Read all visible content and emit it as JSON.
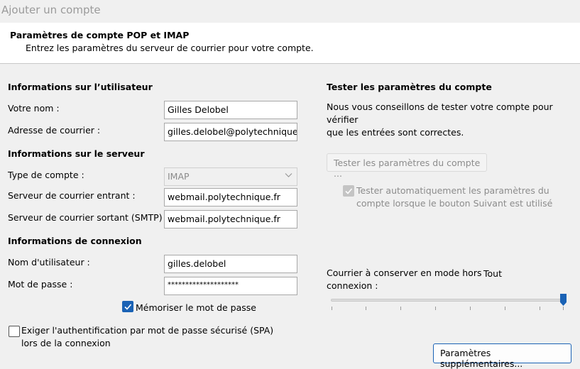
{
  "window": {
    "title": "Ajouter un compte"
  },
  "header": {
    "title": "Paramètres de compte POP et IMAP",
    "subtitle": "Entrez les paramètres du serveur de courrier pour votre compte."
  },
  "user_info": {
    "heading": "Informations sur l’utilisateur",
    "name_label": "Votre nom :",
    "name_value": "Gilles Delobel",
    "email_label": "Adresse de courrier :",
    "email_value": "gilles.delobel@polytechnique.e"
  },
  "server_info": {
    "heading": "Informations sur le serveur",
    "account_type_label": "Type de compte :",
    "account_type_value": "IMAP",
    "incoming_label": "Serveur de courrier entrant :",
    "incoming_value": "webmail.polytechnique.fr",
    "outgoing_label": "Serveur de courrier sortant (SMTP) :",
    "outgoing_value": "webmail.polytechnique.fr"
  },
  "login_info": {
    "heading": "Informations de connexion",
    "username_label": "Nom d'utilisateur :",
    "username_value": "gilles.delobel",
    "password_label": "Mot de passe :",
    "password_value": "********************",
    "remember_label": "Mémoriser le mot de passe",
    "remember_checked": true,
    "spa_label_line1": "Exiger l'authentification par mot de passe sécurisé (SPA)",
    "spa_label_line2": "lors de la connexion",
    "spa_checked": false
  },
  "test": {
    "heading": "Tester les paramètres du compte",
    "desc_line1": "Nous vous conseillons de tester votre compte pour vérifier",
    "desc_line2": "que les entrées sont correctes.",
    "button_label": "Tester les paramètres du compte ...",
    "auto_line1": "Tester automatiquement les paramètres du",
    "auto_line2": "compte lorsque le bouton Suivant est utilisé",
    "auto_checked": true
  },
  "offline": {
    "label_line1": "Courrier à conserver en mode hors",
    "label_line2": "connexion :",
    "value_label": "Tout",
    "slider_fraction": 1.0
  },
  "more_settings_label": "Paramètres supplémentaires...",
  "colors": {
    "accent": "#1a62b5"
  },
  "icons": {
    "check": "check-icon",
    "dropdown": "chevron-down-icon"
  }
}
